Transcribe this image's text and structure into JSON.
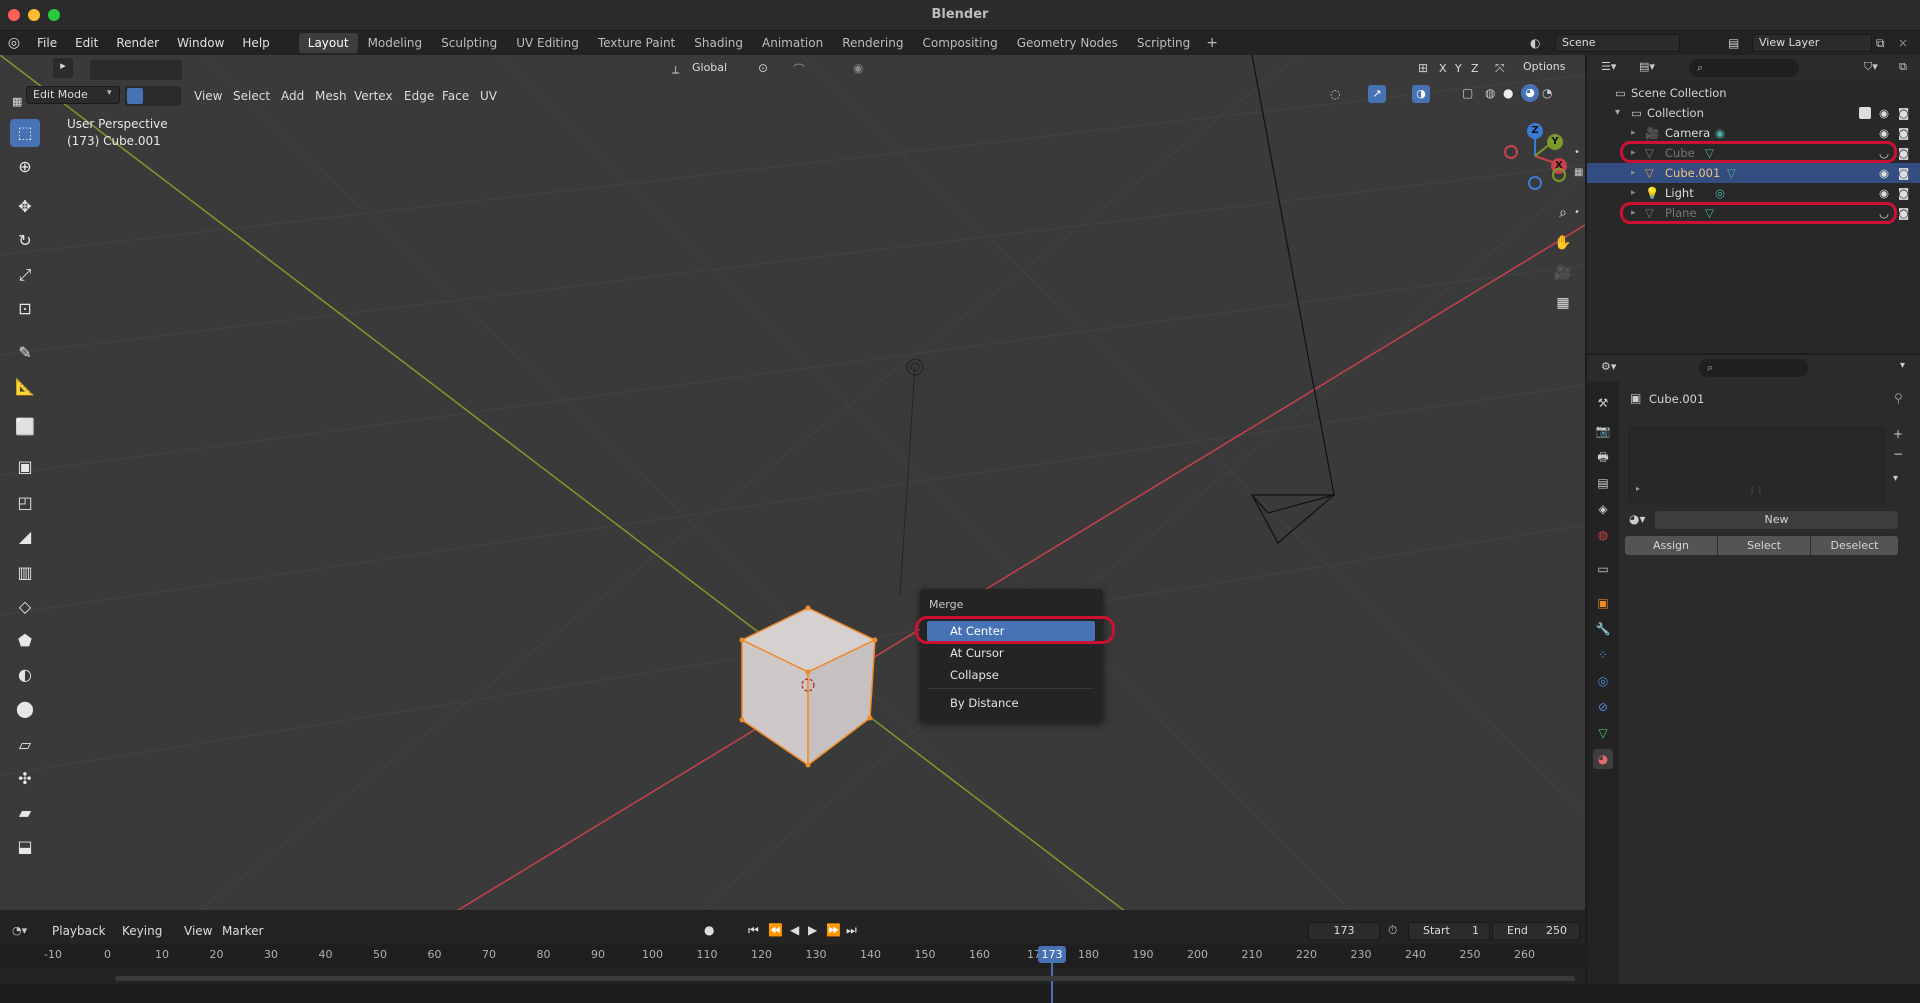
{
  "window": {
    "title": "Blender"
  },
  "menu": [
    "File",
    "Edit",
    "Render",
    "Window",
    "Help"
  ],
  "workspaces": [
    "Layout",
    "Modeling",
    "Sculpting",
    "UV Editing",
    "Texture Paint",
    "Shading",
    "Animation",
    "Rendering",
    "Compositing",
    "Geometry Nodes",
    "Scripting"
  ],
  "scene": {
    "scene_name": "Scene",
    "view_layer": "View Layer"
  },
  "viewport_header": {
    "mode": "Edit Mode",
    "menus": [
      "View",
      "Select",
      "Add",
      "Mesh",
      "Vertex",
      "Edge",
      "Face",
      "UV"
    ],
    "transform_orientation": "Global",
    "axes": [
      "X",
      "Y",
      "Z"
    ],
    "options_label": "Options"
  },
  "viewport": {
    "perspective": "User Perspective",
    "object_info": "(173) Cube.001",
    "gizmo_axes": [
      "X",
      "Y",
      "Z"
    ]
  },
  "merge_menu": {
    "title": "Merge",
    "items": [
      {
        "label": "At Center",
        "selected": true
      },
      {
        "label": "At Cursor",
        "selected": false
      },
      {
        "label": "Collapse",
        "selected": false
      },
      {
        "label": "By Distance",
        "selected": false
      }
    ]
  },
  "outliner": {
    "root": "Scene Collection",
    "collection": "Collection",
    "items": [
      {
        "name": "Camera",
        "type": "camera",
        "visible": true,
        "selected": false,
        "dimmed": false
      },
      {
        "name": "Cube",
        "type": "mesh",
        "visible": false,
        "selected": false,
        "dimmed": true
      },
      {
        "name": "Cube.001",
        "type": "mesh",
        "visible": true,
        "selected": true,
        "dimmed": false
      },
      {
        "name": "Light",
        "type": "light",
        "visible": true,
        "selected": false,
        "dimmed": false
      },
      {
        "name": "Plane",
        "type": "mesh",
        "visible": false,
        "selected": false,
        "dimmed": true
      }
    ]
  },
  "properties": {
    "object_name": "Cube.001",
    "new_label": "New",
    "buttons": [
      "Assign",
      "Select",
      "Deselect"
    ]
  },
  "timeline": {
    "menus": [
      "Playback",
      "Keying",
      "View",
      "Marker"
    ],
    "current_frame": "173",
    "start_label": "Start",
    "start_value": "1",
    "end_label": "End",
    "end_value": "250",
    "ruler_ticks": [
      "-10",
      "0",
      "10",
      "20",
      "30",
      "40",
      "50",
      "60",
      "70",
      "80",
      "90",
      "100",
      "110",
      "120",
      "130",
      "140",
      "150",
      "160",
      "17",
      "180",
      "190",
      "200",
      "210",
      "220",
      "230",
      "240",
      "250",
      "260"
    ]
  },
  "colors": {
    "accent": "#4772b3",
    "highlight_ring": "#cc1133",
    "x_axis": "#c8414b",
    "y_axis": "#7c9a2a",
    "z_axis": "#3b7bd8"
  }
}
